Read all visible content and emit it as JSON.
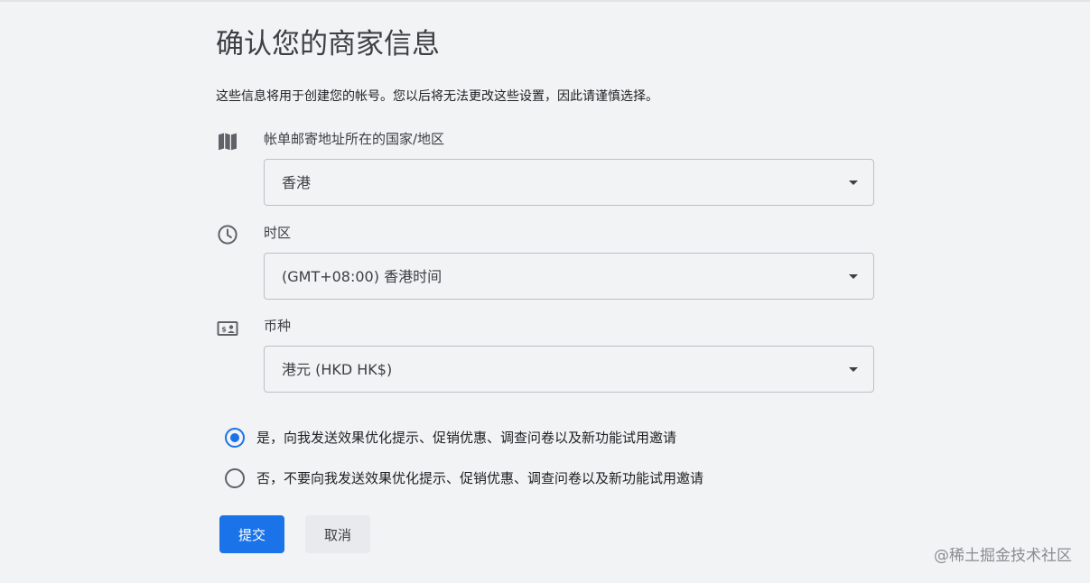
{
  "title": "确认您的商家信息",
  "subtitle": "这些信息将用于创建您的帐号。您以后将无法更改这些设置，因此请谨慎选择。",
  "fields": {
    "country": {
      "icon": "map-icon",
      "label": "帐单邮寄地址所在的国家/地区",
      "value": "香港"
    },
    "timezone": {
      "icon": "clock-icon",
      "label": "时区",
      "value": "(GMT+08:00) 香港时间"
    },
    "currency": {
      "icon": "currency-card-icon",
      "label": "币种",
      "value": "港元 (HKD HK$)"
    }
  },
  "consent": {
    "options": [
      {
        "label": "是，向我发送效果优化提示、促销优惠、调查问卷以及新功能试用邀请",
        "selected": true
      },
      {
        "label": "否，不要向我发送效果优化提示、促销优惠、调查问卷以及新功能试用邀请",
        "selected": false
      }
    ]
  },
  "buttons": {
    "submit": "提交",
    "cancel": "取消"
  },
  "watermark": "@稀土掘金技术社区",
  "colors": {
    "primary": "#1a73e8",
    "background": "#f1f3f4",
    "border": "#bdc1c6",
    "icon": "#5f6368"
  }
}
